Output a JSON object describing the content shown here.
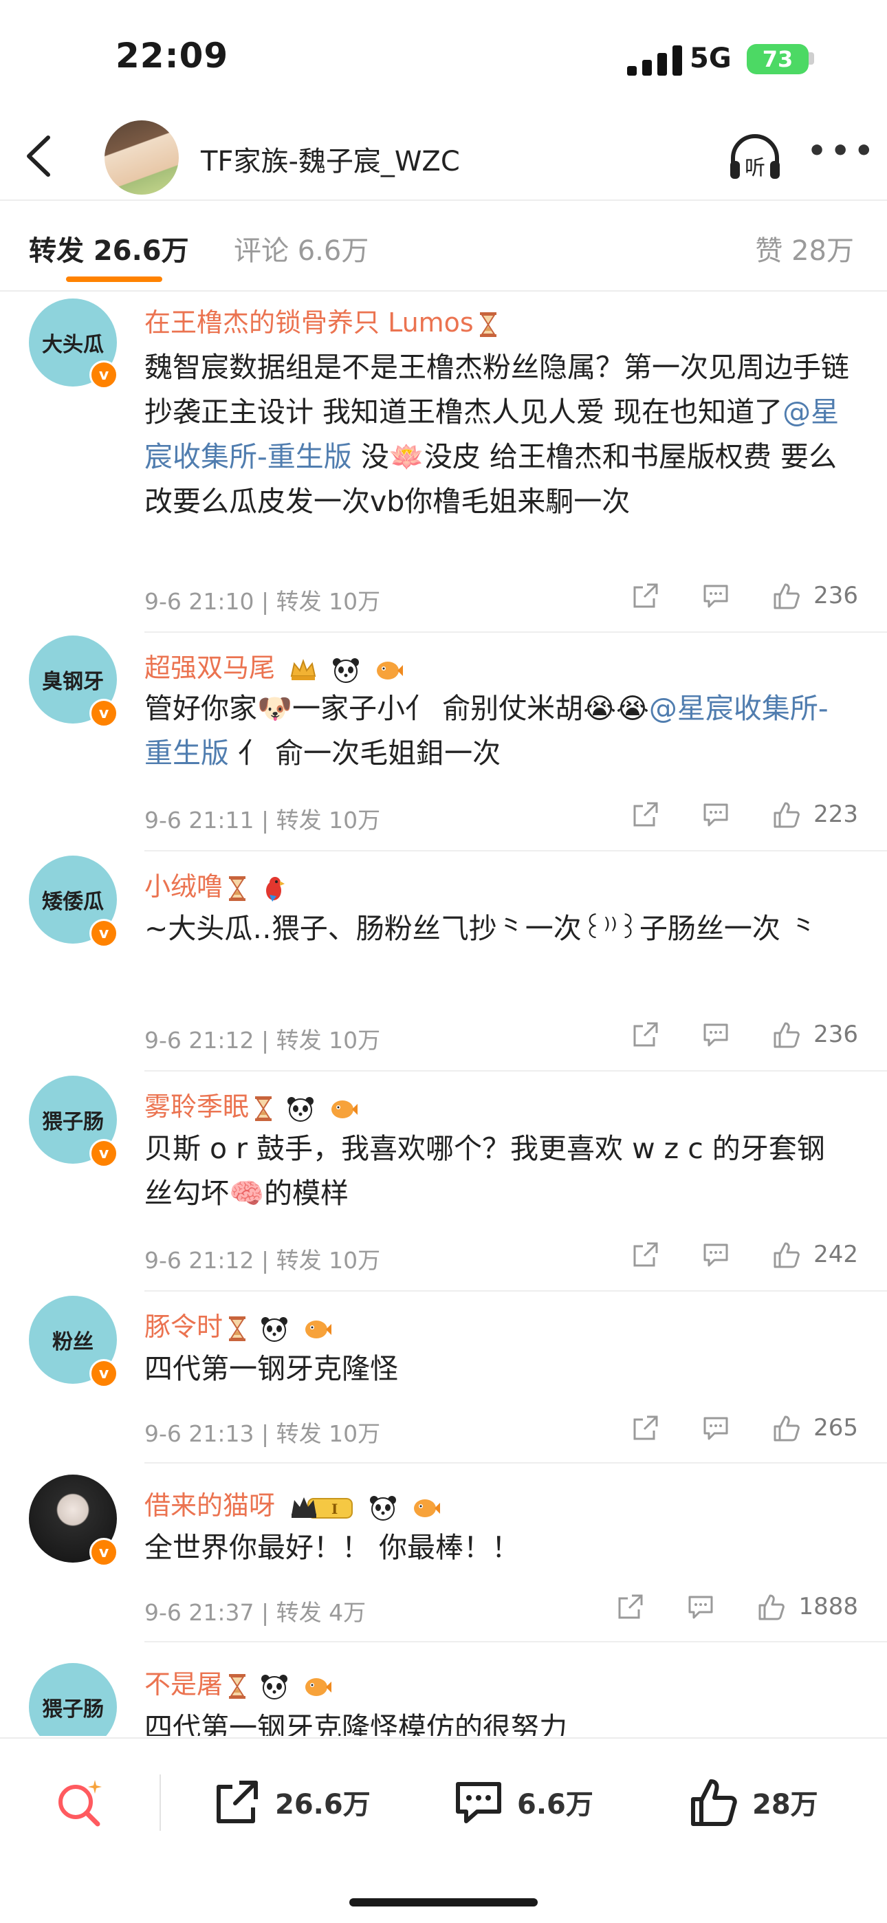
{
  "status_bar": {
    "time": "22:09",
    "network": "5G",
    "battery": "73"
  },
  "header": {
    "title": "TF家族-魏子宸_WZC",
    "listen_icon": "listen-icon",
    "more_icon": "more-icon"
  },
  "tabs": [
    {
      "label": "转发 26.6万",
      "active": true
    },
    {
      "label": "评论 6.6万",
      "active": false
    },
    {
      "label": "赞 28万",
      "active": false
    }
  ],
  "colors": {
    "accent": "#ff8200",
    "username": "#eb7350",
    "mention": "#507daf",
    "avatar_bg": "#8ed3dc"
  },
  "reposts": [
    {
      "avatar_text": "大头瓜",
      "username": "在王橹杰的锁骨养只 Lumos",
      "badges": [
        "hourglass"
      ],
      "text_parts": [
        {
          "t": "魏智宸数据组是不是王橹杰粉丝隐属？第一次见周边手链抄袭正主设计 我知道王橹杰人见人爱 现在也知道了"
        },
        {
          "t": "@星宸收集所-重生版",
          "mention": true
        },
        {
          "t": " 没🪷没皮 给王橹杰和书屋版权费 要么改要么瓜皮发一次vb你橹毛姐来駉一次"
        }
      ],
      "meta": "9-6 21:10 | 转发 10万",
      "likes": "236"
    },
    {
      "avatar_text": "臭钢牙",
      "username": "超强双马尾",
      "badges": [
        "crown",
        "panda",
        "fish"
      ],
      "text_parts": [
        {
          "t": "管好你家🐶一家子小亻 俞别仗米胡😭😭"
        },
        {
          "t": "@星宸收集所-重生版",
          "mention": true
        },
        {
          "t": " 亻 俞一次毛姐鉬一次"
        }
      ],
      "meta": "9-6 21:11 | 转发 10万",
      "likes": "223"
    },
    {
      "avatar_text": "矮倭瓜",
      "username": "小绒噜",
      "badges": [
        "hourglass",
        "parrot"
      ],
      "text_parts": [
        {
          "t": "~大头瓜‥猥子、肠粉丝⺄抄⺀一次꒰⁾⁾꒱子肠丝一次 ⺀"
        }
      ],
      "meta": "9-6 21:12 | 转发 10万",
      "likes": "236"
    },
    {
      "avatar_text": "猥子肠",
      "username": "雾聆季眠",
      "badges": [
        "hourglass",
        "panda",
        "fish"
      ],
      "text_parts": [
        {
          "t": "贝斯 o r 鼓手，我喜欢哪个？我更喜欢 w z c 的牙套钢丝勾坏🧠的模样"
        }
      ],
      "meta": "9-6 21:12 | 转发 10万",
      "likes": "242"
    },
    {
      "avatar_text": "粉丝",
      "username": "豚令时",
      "badges": [
        "hourglass",
        "panda",
        "fish"
      ],
      "text_parts": [
        {
          "t": "四代第一钢牙克隆怪"
        }
      ],
      "meta": "9-6 21:13 | 转发 10万",
      "likes": "265"
    },
    {
      "avatar_text": "",
      "username": "借来的猫呀",
      "badges": [
        "crown-level",
        "panda",
        "fish"
      ],
      "text_parts": [
        {
          "t": "全世界你最好！！ 你最棒！！"
        }
      ],
      "meta": "9-6 21:37 | 转发 4万",
      "likes": "1888"
    },
    {
      "avatar_text": "猥子肠",
      "username": "不是屠",
      "badges": [
        "hourglass",
        "panda",
        "fish"
      ],
      "text_parts": [
        {
          "t": "四代第一钢牙克隆怪模仿的很努力"
        }
      ],
      "meta": "",
      "likes": ""
    }
  ],
  "bottom_bar": {
    "repost_count": "26.6万",
    "comment_count": "6.6万",
    "like_count": "28万"
  }
}
